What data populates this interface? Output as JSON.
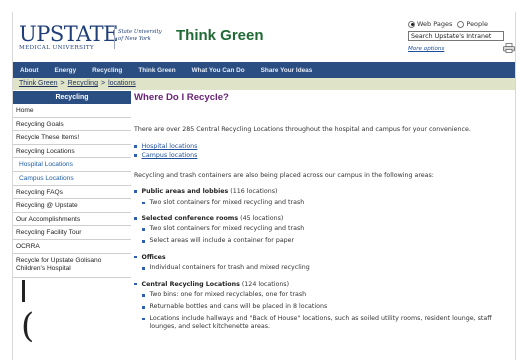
{
  "header": {
    "logo_word": "UPSTATE",
    "logo_sub": "MEDICAL UNIVERSITY",
    "state_uni_line1": "State University",
    "state_uni_line2": "of New York",
    "site_title": "Think Green"
  },
  "search": {
    "option_web": "Web Pages",
    "option_people": "People",
    "input_value": "Search Upstate's Intranet",
    "more_options": "More options"
  },
  "nav": {
    "items": [
      "About",
      "Energy",
      "Recycling",
      "Think Green",
      "What You Can Do",
      "Share Your Ideas"
    ]
  },
  "breadcrumb": {
    "items": [
      "Think Green",
      "Recycling",
      "locations"
    ],
    "separator": ">"
  },
  "sidebar": {
    "header": "Recycling",
    "items": [
      "Home",
      "Recycling Goals",
      "Recycle These Items!",
      "Recycling Locations",
      "Hospital Locations",
      "Campus Locations",
      "Recycling FAQs",
      "Recycling @ Upstate",
      "Our Accomplishments",
      "Recycling Facility Tour",
      "OCRRA",
      "Recycle for Upstate Golisano Children's Hospital"
    ]
  },
  "main": {
    "title": "Where Do I Recycle?",
    "intro": "There are over 285 Central Recycling Locations throughout the hospital and campus for your convenience.",
    "links": [
      "Hospital locations",
      "Campus locations"
    ],
    "para2": "Recycling and trash containers are also being placed across our campus in the following areas:",
    "sections": [
      {
        "title": "Public areas and lobbies",
        "count": "(116 locations)",
        "items": [
          "Two slot containers for mixed recycling and trash"
        ]
      },
      {
        "title": "Selected conference rooms",
        "count": "(45 locations)",
        "items": [
          "Two slot containers for mixed recycling and trash",
          "Select areas will include a container for paper"
        ]
      },
      {
        "title": "Offices",
        "count": "",
        "items": [
          "Individual containers for trash and mixed recycling"
        ]
      },
      {
        "title": "Central Recycling Locations",
        "count": "(124 locations)",
        "items": [
          "Two bins: one for mixed recyclables, one for trash",
          "Returnable bottles and cans will be placed in 8 locations",
          "Locations include hallways and \"Back of House\" locations, such as soiled utility rooms, resident lounge, staff lounges, and select kitchenette areas."
        ]
      }
    ]
  },
  "colors": {
    "nav_blue": "#2a4d82",
    "title_green": "#1f6a34",
    "heading_purple": "#6a2178",
    "breadcrumb_bg": "#dfe3c8",
    "link_blue": "#1f4f9a"
  }
}
